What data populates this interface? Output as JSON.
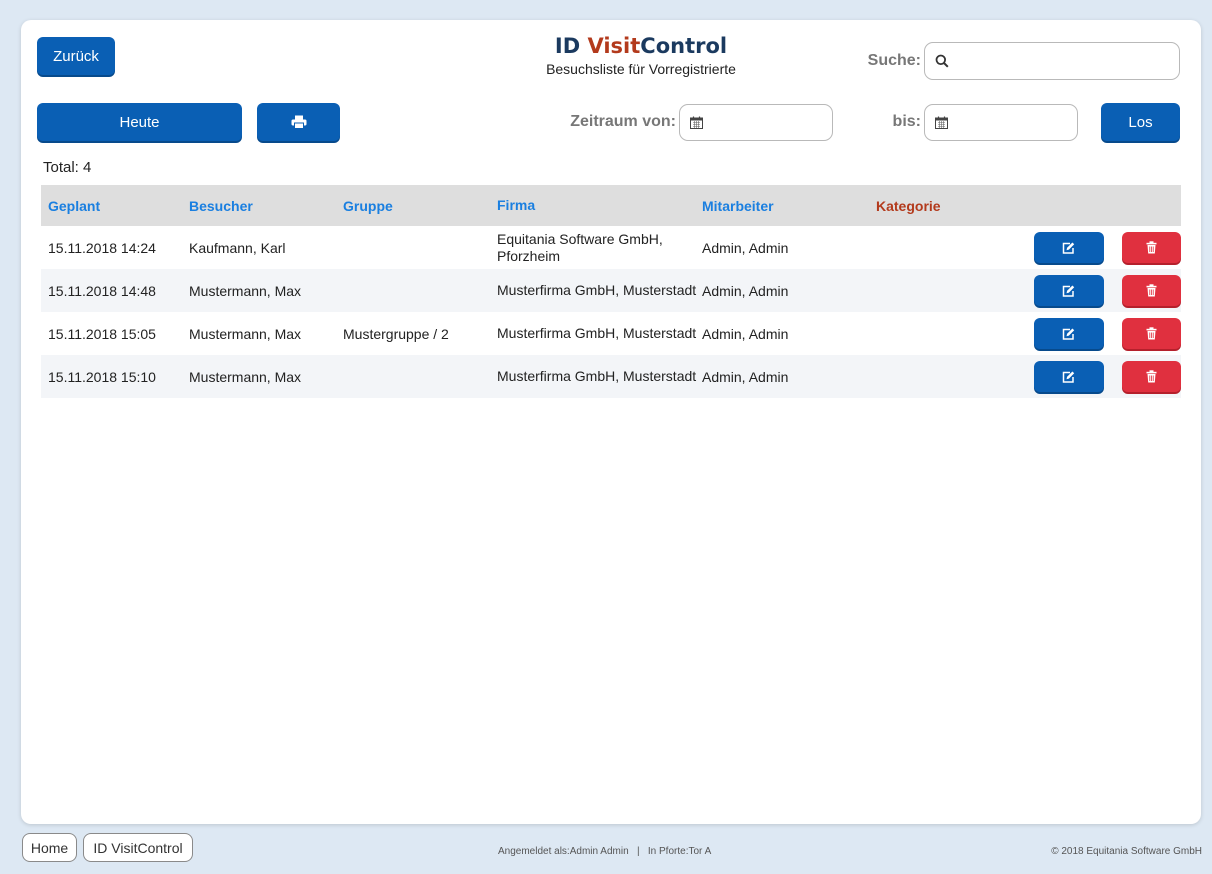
{
  "header": {
    "back_label": "Zurück",
    "logo_prefix": "ID ",
    "logo_accent": "Visit",
    "logo_suffix": "Control",
    "subtitle": "Besuchsliste für Vorregistrierte",
    "search_label": "Suche:",
    "search_value": ""
  },
  "filter": {
    "today_label": "Heute",
    "from_label": "Zeitraum von:",
    "to_label": "bis:",
    "go_label": "Los",
    "from_value": "",
    "to_value": ""
  },
  "total": "Total: 4",
  "table": {
    "headers": {
      "geplant": "Geplant",
      "besucher": "Besucher",
      "gruppe": "Gruppe",
      "firma": "Firma",
      "mitarbeiter": "Mitarbeiter",
      "kategorie": "Kategorie"
    },
    "rows": [
      {
        "geplant": "15.11.2018 14:24",
        "besucher": "Kaufmann, Karl",
        "gruppe": "",
        "firma": "Equitania Software GmbH, Pforzheim",
        "mitarbeiter": "Admin, Admin",
        "kategorie": ""
      },
      {
        "geplant": "15.11.2018 14:48",
        "besucher": "Mustermann, Max",
        "gruppe": "",
        "firma": "Musterfirma GmbH, Musterstadt",
        "mitarbeiter": "Admin, Admin",
        "kategorie": ""
      },
      {
        "geplant": "15.11.2018 15:05",
        "besucher": "Mustermann, Max",
        "gruppe": "Mustergruppe / 2",
        "firma": "Musterfirma GmbH, Musterstadt",
        "mitarbeiter": "Admin, Admin",
        "kategorie": ""
      },
      {
        "geplant": "15.11.2018 15:10",
        "besucher": "Mustermann, Max",
        "gruppe": "",
        "firma": "Musterfirma GmbH, Musterstadt",
        "mitarbeiter": "Admin, Admin",
        "kategorie": ""
      }
    ]
  },
  "footer": {
    "home_label": "Home",
    "app_label": "ID VisitControl",
    "session_info": "Angemeldet als:Admin Admin   |   In Pforte:Tor A",
    "copyright": "© 2018 Equitania Software GmbH"
  },
  "icons": {
    "search": "search-icon",
    "print": "print-icon",
    "calendar": "calendar-icon",
    "edit": "edit-icon",
    "delete": "trash-icon"
  },
  "colors": {
    "primary": "#0a5fb4",
    "danger": "#e0303f",
    "header_link": "#1a7fe0",
    "logo_dark": "#1b3a5f",
    "logo_accent": "#b33a1c"
  }
}
